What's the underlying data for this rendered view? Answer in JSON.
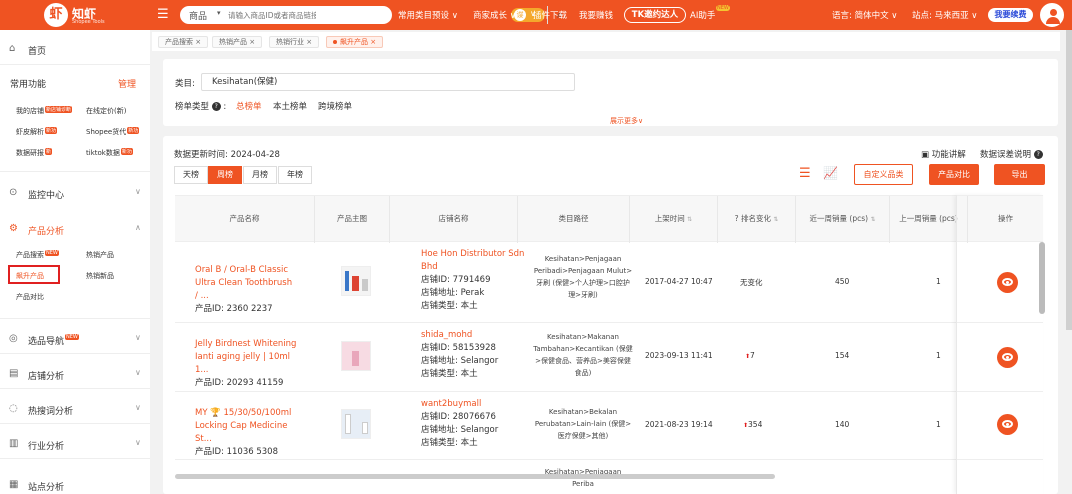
{
  "header": {
    "logo_name": "知虾",
    "logo_sub": "Shopee Tools",
    "search": {
      "category": "商品",
      "placeholder": "请输入商品ID或者商品链接",
      "pill_label": "谍"
    },
    "nav": [
      "常用类目预设 ∨",
      "商家成长 ∨",
      "插件下载",
      "我要赚钱"
    ],
    "tk_button": "TK邀约达人",
    "ai_label": "AI助手",
    "ai_badge": "NEW",
    "language": "语言: 简体中文 ∨",
    "site": "站点: 马来西亚 ∨",
    "renew": "我要续费"
  },
  "sidebar": {
    "home": "首页",
    "common": "常用功能",
    "manage": "管理",
    "common_items": [
      {
        "label": "我的店铺",
        "badge": "新店铺诊断"
      },
      {
        "label": "在线定价(新)",
        "badge": ""
      },
      {
        "label": "虾皮解析",
        "badge": "新功"
      },
      {
        "label": "Shopee货代",
        "badge": "新功"
      },
      {
        "label": "数据研报",
        "badge": "新"
      },
      {
        "label": "tiktok数据",
        "badge": "新功"
      }
    ],
    "monitor": "监控中心",
    "product_analysis": "产品分析",
    "product_sub": [
      {
        "label": "产品搜索",
        "badge": "NEW"
      },
      {
        "label": "热销产品",
        "badge": ""
      },
      {
        "label": "飙升产品",
        "badge": ""
      },
      {
        "label": "热销新品",
        "badge": ""
      },
      {
        "label": "产品对比",
        "badge": ""
      }
    ],
    "select_nav": "选品导航",
    "select_badge": "NEW",
    "store_analysis": "店铺分析",
    "keyword_analysis": "热搜词分析",
    "industry_analysis": "行业分析",
    "more_analysis": "站点分析"
  },
  "breadcrumbs": [
    "产品搜索 ×",
    "热销产品 ×",
    "热销行业 ×",
    "飙升产品 ×"
  ],
  "filter": {
    "category_label": "类目:",
    "category_value": "Kesihatan(保健)",
    "type_label": "榜单类型",
    "type_q": "?",
    "types": [
      "总榜单",
      "本土榜单",
      "跨境榜单"
    ],
    "more": "展示更多∨"
  },
  "main": {
    "update_time": "数据更新时间: 2024-04-28",
    "feature_intro": "功能讲解",
    "error_note": "数据误差说明",
    "periods": [
      "天榜",
      "周榜",
      "月榜",
      "年榜"
    ],
    "active_period": "周榜",
    "custom_btn": "自定义品类",
    "compare_btn": "产品对比",
    "export_btn": "导出",
    "columns": [
      "产品名称",
      "产品主图",
      "店铺名称",
      "类目路径",
      "上架时间",
      "排名变化",
      "近一周销量 (pcs)",
      "上一周销量 (pcs)",
      "操作"
    ],
    "rows": [
      {
        "name": "Oral B / Oral-B Classic Ultra Clean Toothbrush / ...",
        "pid": "产品ID: 2360 2237",
        "store": "Hoe Hon Distributor Sdn Bhd",
        "store_id": "店铺ID: 7791469",
        "store_loc": "店铺地址: Perak",
        "store_type": "店铺类型: 本土",
        "cat": "Kesihatan>Penjagaan Peribadi>Penjagaan Mulut>牙刷 (保健>个人护理>口腔护理>牙刷)",
        "time": "2017-04-27 10:47",
        "rank": "无变化",
        "week": "450",
        "prev": "1"
      },
      {
        "name": "Jelly Birdnest Whitening Ianti aging jelly | 10ml 1...",
        "pid": "产品ID: 20293 41159",
        "store": "shida_mohd",
        "store_id": "店铺ID: 58153928",
        "store_loc": "店铺地址: Selangor",
        "store_type": "店铺类型: 本土",
        "cat": "Kesihatan>Makanan Tambahan>Kecantikan (保健>保健食品、营养品>美容保健食品)",
        "time": "2023-09-13 11:41",
        "rank": "7",
        "week": "154",
        "prev": "1"
      },
      {
        "name": "MY 🏆 15/30/50/100ml Locking Cap Medicine St...",
        "pid": "产品ID: 11036 5308",
        "store": "want2buymall",
        "store_id": "店铺ID: 28076676",
        "store_loc": "店铺地址: Selangor",
        "store_type": "店铺类型: 本土",
        "cat": "Kesihatan>Bekalan Perubatan>Lain-lain (保健>医疗保健>其他)",
        "time": "2021-08-23 19:14",
        "rank": "354",
        "week": "140",
        "prev": "1"
      }
    ],
    "partial_row_cat": "Kesihatan>Penjagaan Periba"
  },
  "colors": {
    "brand": "#ef5322",
    "renew_text": "#2a49d8"
  }
}
